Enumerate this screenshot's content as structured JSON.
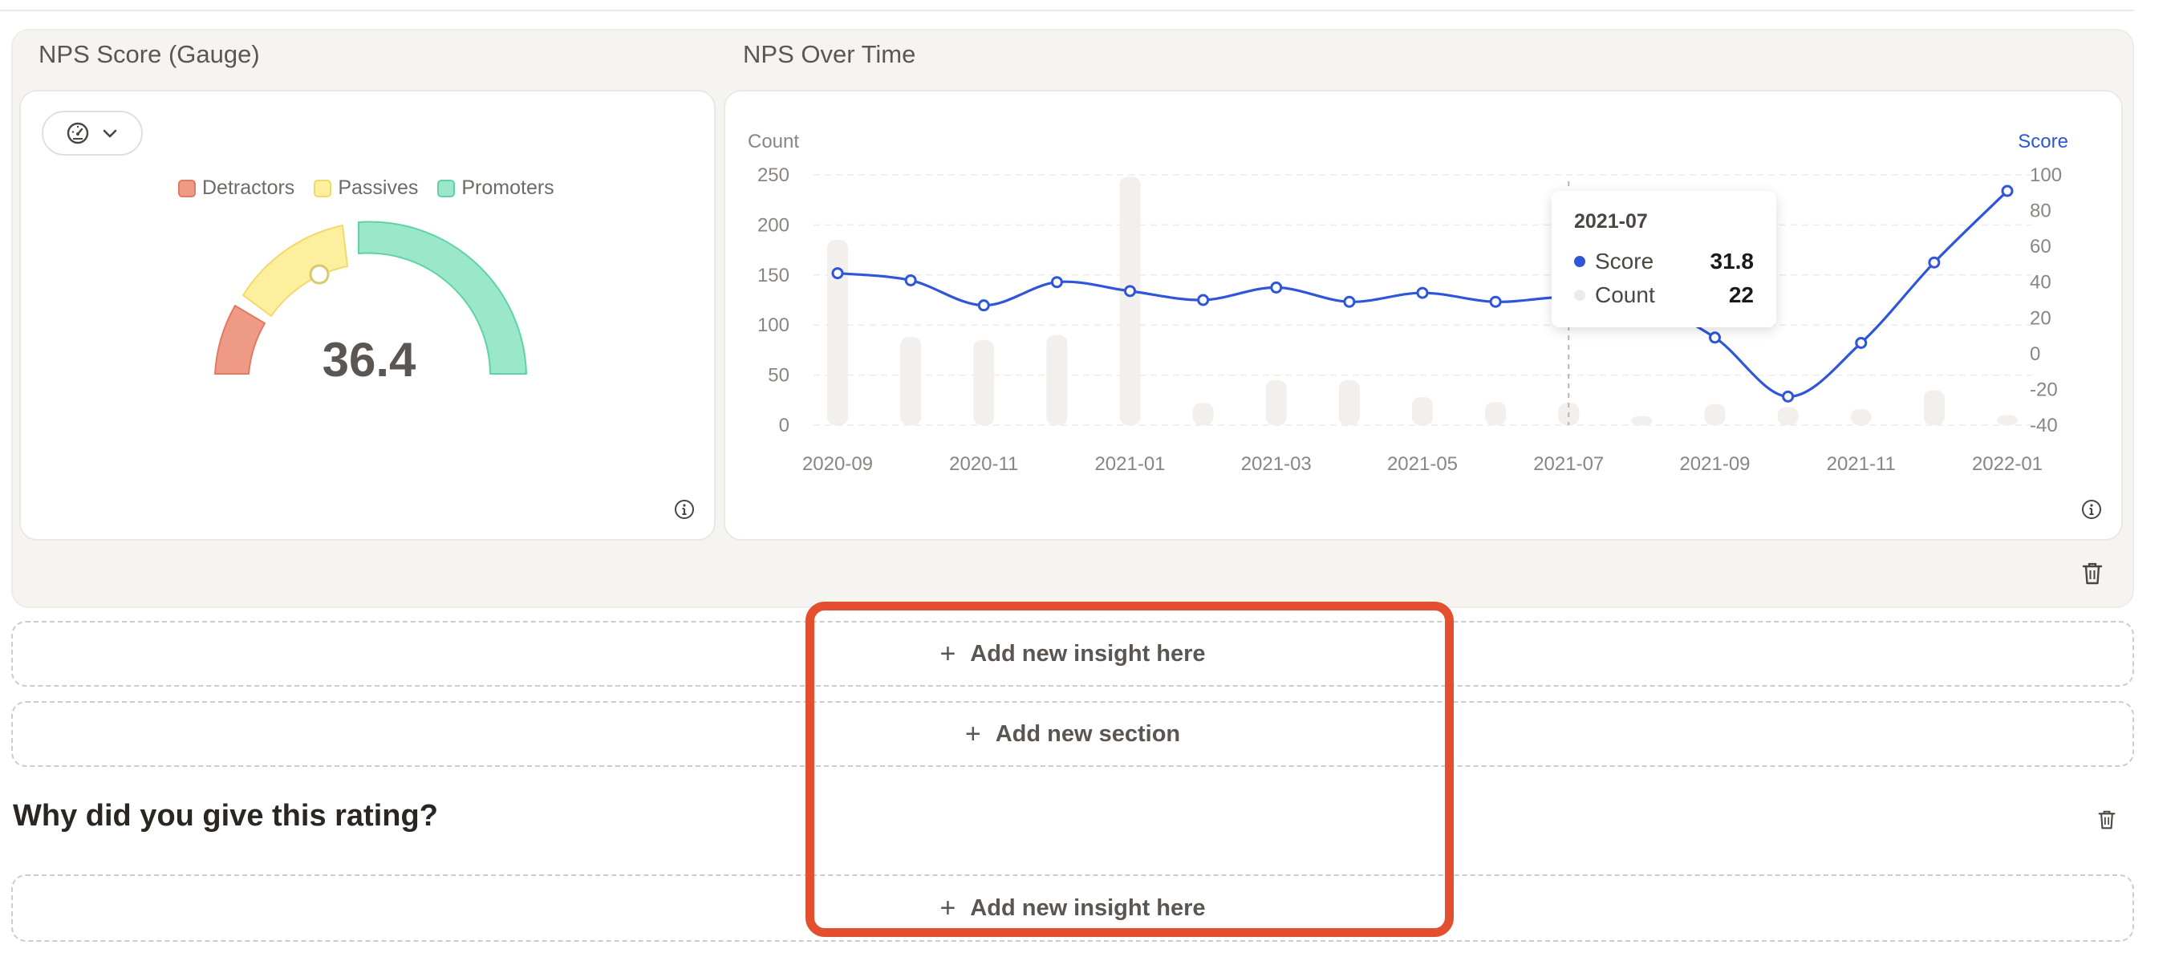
{
  "gauge_widget": {
    "title": "NPS Score (Gauge)",
    "score": "36.4",
    "legend": [
      {
        "label": "Detractors",
        "color": "#ee9a85"
      },
      {
        "label": "Passives",
        "color": "#fcef9e"
      },
      {
        "label": "Promoters",
        "color": "#9ae8c9"
      }
    ],
    "viz_icon": "gauge-icon",
    "dropdown_icon": "chevron-down-icon"
  },
  "trend_widget": {
    "title": "NPS Over Time",
    "tooltip": {
      "date": "2021-07",
      "rows": [
        {
          "label": "Score",
          "value": "31.8",
          "color": "#2f56d8"
        },
        {
          "label": "Count",
          "value": "22",
          "color": "#ecebe9"
        }
      ]
    }
  },
  "chart_data": {
    "type": "line",
    "title": "",
    "x": [
      "2020-09",
      "2020-10",
      "2020-11",
      "2020-12",
      "2021-01",
      "2021-02",
      "2021-03",
      "2021-04",
      "2021-05",
      "2021-06",
      "2021-07",
      "2021-08",
      "2021-09",
      "2021-10",
      "2021-11",
      "2021-12",
      "2022-01"
    ],
    "x_tick_labels": [
      "2020-09",
      "2020-11",
      "2021-01",
      "2021-03",
      "2021-05",
      "2021-07",
      "2021-09",
      "2021-11",
      "2022-01"
    ],
    "series": [
      {
        "name": "Score",
        "axis": "right",
        "kind": "line",
        "color": "#2f56d8",
        "values": [
          45,
          41,
          27,
          40,
          35,
          30,
          37,
          29,
          34,
          29,
          31.8,
          29,
          9,
          -24,
          6,
          51,
          91
        ]
      },
      {
        "name": "Count",
        "axis": "left",
        "kind": "bar",
        "color": "#f2efec",
        "values": [
          185,
          88,
          85,
          90,
          248,
          22,
          45,
          45,
          28,
          23,
          22,
          9,
          21,
          18,
          16,
          35,
          10
        ]
      }
    ],
    "left_axis": {
      "label": "Count",
      "ylim": [
        0,
        250
      ],
      "ticks": [
        0,
        50,
        100,
        150,
        200,
        250
      ]
    },
    "right_axis": {
      "label": "Score",
      "ylim": [
        -40,
        100
      ],
      "ticks": [
        -40,
        -20,
        0,
        20,
        40,
        60,
        80,
        100
      ]
    },
    "hover_index": 10,
    "grid": true
  },
  "actions": {
    "add_insight": "Add new insight here",
    "add_section": "Add new section",
    "plus": "+"
  },
  "next_section": {
    "title": "Why did you give this rating?"
  }
}
